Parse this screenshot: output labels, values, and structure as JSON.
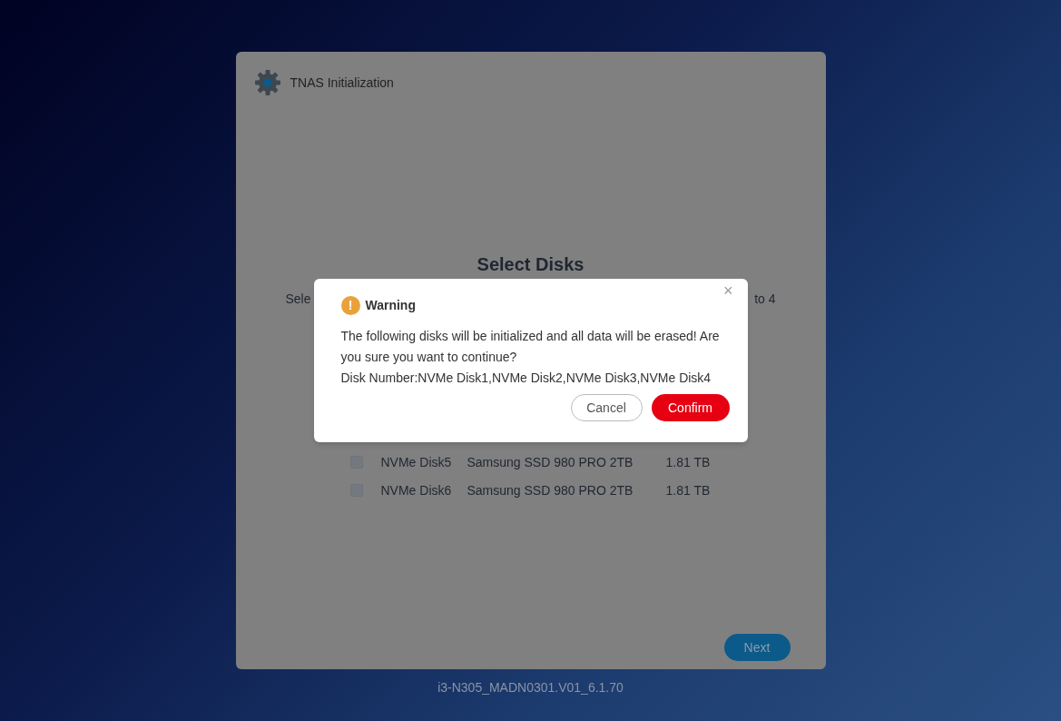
{
  "window": {
    "title": "TNAS Initialization"
  },
  "page": {
    "heading": "Select Disks",
    "subtitle_left": "Sele",
    "subtitle_right": "to 4"
  },
  "disks": [
    {
      "name": "NVMe Disk5",
      "model": "Samsung SSD 980 PRO 2TB",
      "size": "1.81 TB",
      "checked": false
    },
    {
      "name": "NVMe Disk6",
      "model": "Samsung SSD 980 PRO 2TB",
      "size": "1.81 TB",
      "checked": false
    }
  ],
  "next_button": "Next",
  "version": "i3-N305_MADN0301.V01_6.1.70",
  "dialog": {
    "icon": "!",
    "title": "Warning",
    "close": "×",
    "message": "The following disks will be initialized and all data will be erased! Are you sure you want to continue?",
    "disk_line": "Disk Number:NVMe Disk1,NVMe Disk2,NVMe Disk3,NVMe Disk4",
    "cancel": "Cancel",
    "confirm": "Confirm"
  }
}
